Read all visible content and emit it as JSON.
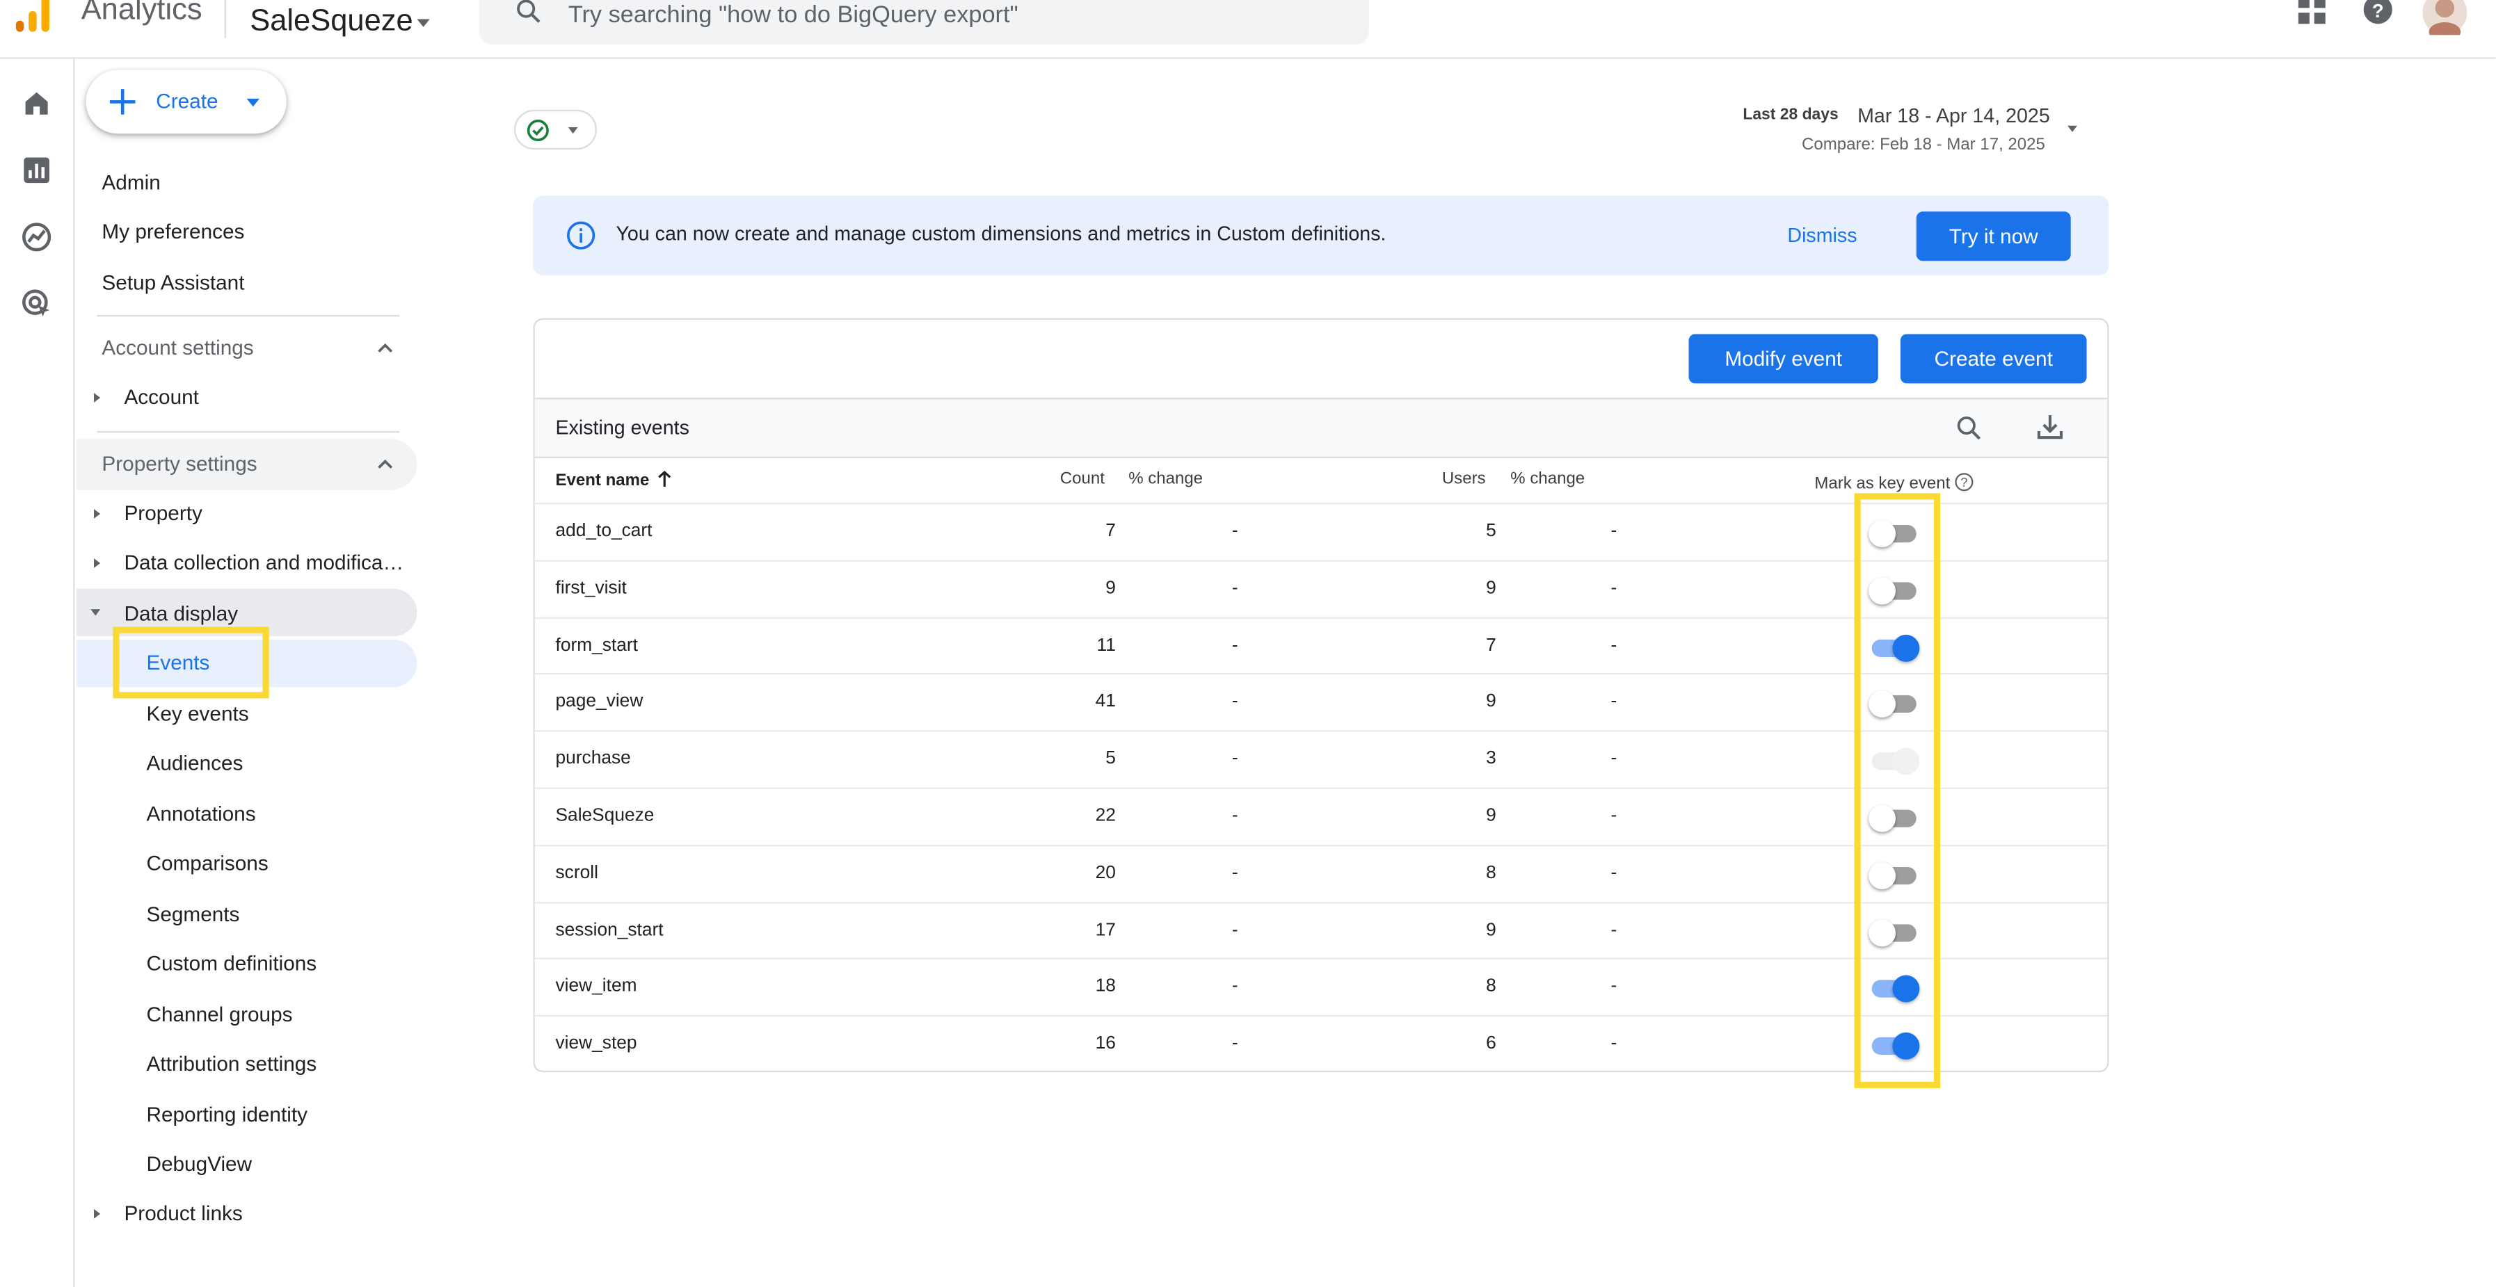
{
  "header": {
    "app_name": "Analytics",
    "property_name": "SaleSqueze",
    "search_placeholder": "Try searching \"how to do BigQuery export\""
  },
  "sidebar": {
    "create_label": "Create",
    "top_items": [
      "Admin",
      "My preferences",
      "Setup Assistant"
    ],
    "account_settings": {
      "label": "Account settings",
      "items": [
        "Account"
      ]
    },
    "property_settings": {
      "label": "Property settings",
      "items": [
        "Property",
        "Data collection and modifica…",
        "Data display"
      ]
    },
    "data_display_items": [
      "Events",
      "Key events",
      "Audiences",
      "Annotations",
      "Comparisons",
      "Segments",
      "Custom definitions",
      "Channel groups",
      "Attribution settings",
      "Reporting identity",
      "DebugView"
    ],
    "product_links": "Product links"
  },
  "date": {
    "label": "Last 28 days",
    "range": "Mar 18 - Apr 14, 2025",
    "compare": "Compare: Feb 18 - Mar 17, 2025"
  },
  "banner": {
    "text": "You can now create and manage custom dimensions and metrics in Custom definitions.",
    "dismiss": "Dismiss",
    "try_it": "Try it now"
  },
  "events": {
    "modify_button": "Modify event",
    "create_button": "Create event",
    "title": "Existing events",
    "columns": [
      "Event name",
      "Count",
      "% change",
      "Users",
      "% change",
      "Mark as key event"
    ],
    "rows": [
      {
        "name": "add_to_cart",
        "count": "7",
        "count_change": "-",
        "users": "5",
        "users_change": "-",
        "key_event": "off"
      },
      {
        "name": "first_visit",
        "count": "9",
        "count_change": "-",
        "users": "9",
        "users_change": "-",
        "key_event": "off"
      },
      {
        "name": "form_start",
        "count": "11",
        "count_change": "-",
        "users": "7",
        "users_change": "-",
        "key_event": "on"
      },
      {
        "name": "page_view",
        "count": "41",
        "count_change": "-",
        "users": "9",
        "users_change": "-",
        "key_event": "off"
      },
      {
        "name": "purchase",
        "count": "5",
        "count_change": "-",
        "users": "3",
        "users_change": "-",
        "key_event": "disabled"
      },
      {
        "name": "SaleSqueze",
        "count": "22",
        "count_change": "-",
        "users": "9",
        "users_change": "-",
        "key_event": "off"
      },
      {
        "name": "scroll",
        "count": "20",
        "count_change": "-",
        "users": "8",
        "users_change": "-",
        "key_event": "off"
      },
      {
        "name": "session_start",
        "count": "17",
        "count_change": "-",
        "users": "9",
        "users_change": "-",
        "key_event": "off"
      },
      {
        "name": "view_item",
        "count": "18",
        "count_change": "-",
        "users": "8",
        "users_change": "-",
        "key_event": "on"
      },
      {
        "name": "view_step",
        "count": "16",
        "count_change": "-",
        "users": "6",
        "users_change": "-",
        "key_event": "on"
      }
    ]
  },
  "colors": {
    "accent": "#1a73e8",
    "highlight": "#fbd934",
    "banner_bg": "#e8f0fe",
    "selected_bg": "#e8f0fe"
  }
}
